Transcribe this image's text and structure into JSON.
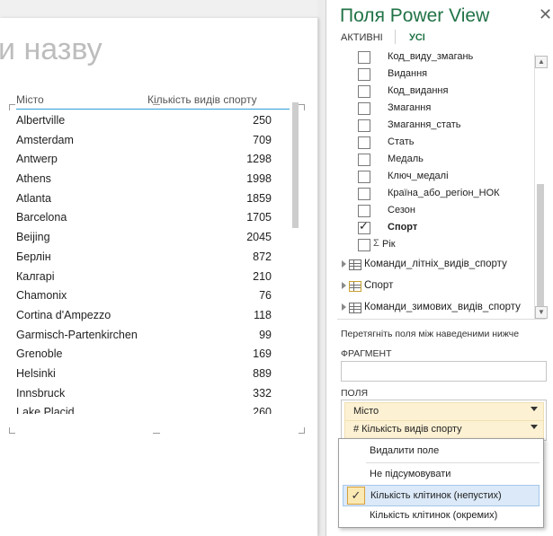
{
  "canvas": {
    "title_placeholder": "и назву",
    "table": {
      "columns": [
        "Місто",
        "Кількість видів спорту"
      ],
      "rows": [
        [
          "Albertville",
          "250"
        ],
        [
          "Amsterdam",
          "709"
        ],
        [
          "Antwerp",
          "1298"
        ],
        [
          "Athens",
          "1998"
        ],
        [
          "Atlanta",
          "1859"
        ],
        [
          "Barcelona",
          "1705"
        ],
        [
          "Beijing",
          "2045"
        ],
        [
          "Берлін",
          "872"
        ],
        [
          "Калгарі",
          "210"
        ],
        [
          "Chamonix",
          "76"
        ],
        [
          "Cortina d'Ampezzo",
          "118"
        ],
        [
          "Garmisch-Partenkirchen",
          "99"
        ],
        [
          "Grenoble",
          "169"
        ],
        [
          "Helsinki",
          "889"
        ],
        [
          "Innsbruck",
          "332"
        ],
        [
          "Lake Placid",
          "260"
        ]
      ]
    }
  },
  "panel": {
    "title": "Поля Power View",
    "close_glyph": "✕",
    "tabs": {
      "active": "АКТИВНІ",
      "all": "УСІ"
    },
    "fields": [
      {
        "label": "Код_виду_змагань",
        "checked": false
      },
      {
        "label": "Видання",
        "checked": false
      },
      {
        "label": "Код_видання",
        "checked": false
      },
      {
        "label": "Змагання",
        "checked": false
      },
      {
        "label": "Змагання_стать",
        "checked": false
      },
      {
        "label": "Стать",
        "checked": false
      },
      {
        "label": "Медаль",
        "checked": false
      },
      {
        "label": "Ключ_медалі",
        "checked": false
      },
      {
        "label": "Країна_або_регіон_НОК",
        "checked": false
      },
      {
        "label": "Сезон",
        "checked": false
      },
      {
        "label": "Спорт",
        "checked": true,
        "bold": true
      },
      {
        "label": "Рік",
        "checked": false,
        "sigma": true
      }
    ],
    "tables": [
      {
        "label": "Команди_літніх_видів_спорту",
        "icon": "table-icon"
      },
      {
        "label": "Спорт",
        "icon": "table-linked-icon"
      },
      {
        "label": "Команди_зимових_видів_спорту",
        "icon": "table-icon"
      }
    ],
    "drag_hint": "Перетягніть поля між наведеними нижче",
    "fragment_label": "ФРАГМЕНТ",
    "fields_label": "ПОЛЯ",
    "wells": [
      "Місто",
      "# Кількість видів спорту"
    ]
  },
  "menu": {
    "items": [
      "Видалити поле",
      "Не підсумовувати",
      "Кількість клітинок (непустих)",
      "Кількість клітинок (окремих)"
    ],
    "selected_index": 2,
    "check_glyph": "✓"
  }
}
